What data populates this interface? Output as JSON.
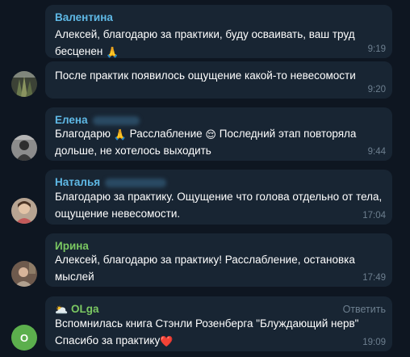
{
  "messages": [
    {
      "sender": "Валентина",
      "sender_color": "#5fb9e6",
      "line1": "Алексей, благодарю за практики, буду осваивать, ваш труд",
      "line2": "бесценен",
      "emoji1": "🙏",
      "time": "9:19"
    },
    {
      "line1": "После практик появилось ощущение какой-то невесомости",
      "time": "9:20",
      "avatar_icon": "plant-photo-avatar"
    },
    {
      "sender": "Елена",
      "sender_color": "#5fb9e6",
      "line1_a": "Благодарю",
      "emoji_pray": "🙏",
      "line1_b": "Расслабление",
      "emoji_relieved": "😌",
      "line1_c": "Последний этап повторяла",
      "line2": "дольше, не хотелось выходить",
      "time": "9:44",
      "avatar_icon": "bw-photo-avatar"
    },
    {
      "sender": "Наталья",
      "sender_color": "#5fb9e6",
      "line1": "Благодарю за практику. Ощущение что голова отдельно от тела,",
      "line2": "ощущение невесомости.",
      "time": "17:04",
      "avatar_icon": "woman-photo-avatar"
    },
    {
      "sender": "Ирина",
      "sender_color": "#7bc862",
      "line1": "Алексей, благодарю за практику! Расслабление, остановка",
      "line2": "мыслей",
      "time": "17:49",
      "avatar_icon": "person-photo-avatar"
    },
    {
      "sender_emoji": "🌥️",
      "sender": "OLga",
      "sender_color": "#7bc862",
      "reply_label": "Ответить",
      "line1": "Вспомнилась книга Стэнли Розенберга \"Блуждающий нерв\"",
      "line2": "Спасибо за практику",
      "emoji_heart": "❤️",
      "time": "19:09",
      "avatar_letter": "O",
      "avatar_color": "#5caf4d"
    }
  ]
}
